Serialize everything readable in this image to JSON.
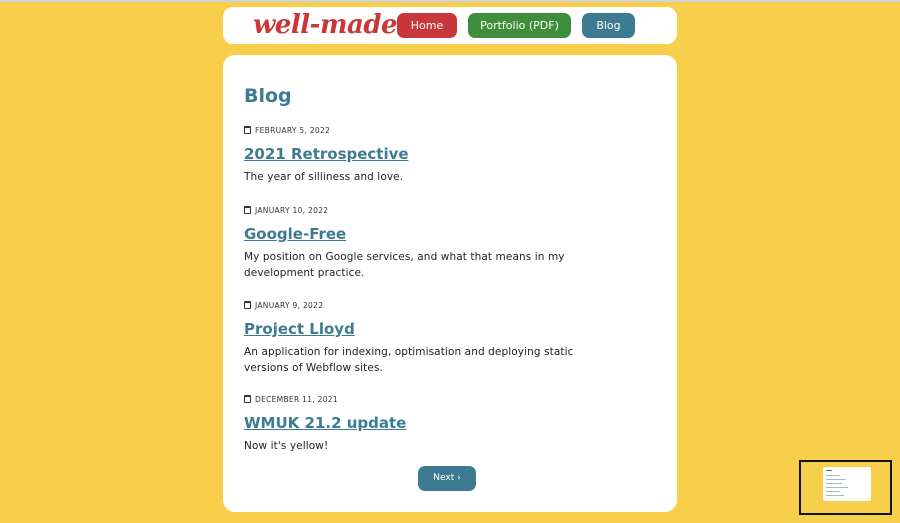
{
  "header": {
    "logo": "well-made",
    "nav": {
      "home": "Home",
      "portfolio": "Portfolio (PDF)",
      "blog": "Blog"
    }
  },
  "main": {
    "title": "Blog",
    "posts": [
      {
        "date": "FEBRUARY 5, 2022",
        "title": "2021 Retrospective",
        "excerpt": "The year of silliness and love."
      },
      {
        "date": "JANUARY 10, 2022",
        "title": "Google-Free",
        "excerpt": "My position on Google services, and what that means in my development practice."
      },
      {
        "date": "JANUARY 9, 2022",
        "title": "Project Lloyd",
        "excerpt": "An application for indexing, optimisation and deploying static versions of Webflow sites."
      },
      {
        "date": "DECEMBER 11, 2021",
        "title": "WMUK 21.2 update",
        "excerpt": "Now it's yellow!"
      }
    ],
    "next_label": "Next ›"
  },
  "colors": {
    "background": "#f7cf4a",
    "brand_red": "#c9373a",
    "green": "#3f8e3c",
    "teal": "#3d7b92"
  },
  "icons": {
    "date": "calendar-icon",
    "next": "chevron-right-icon"
  }
}
